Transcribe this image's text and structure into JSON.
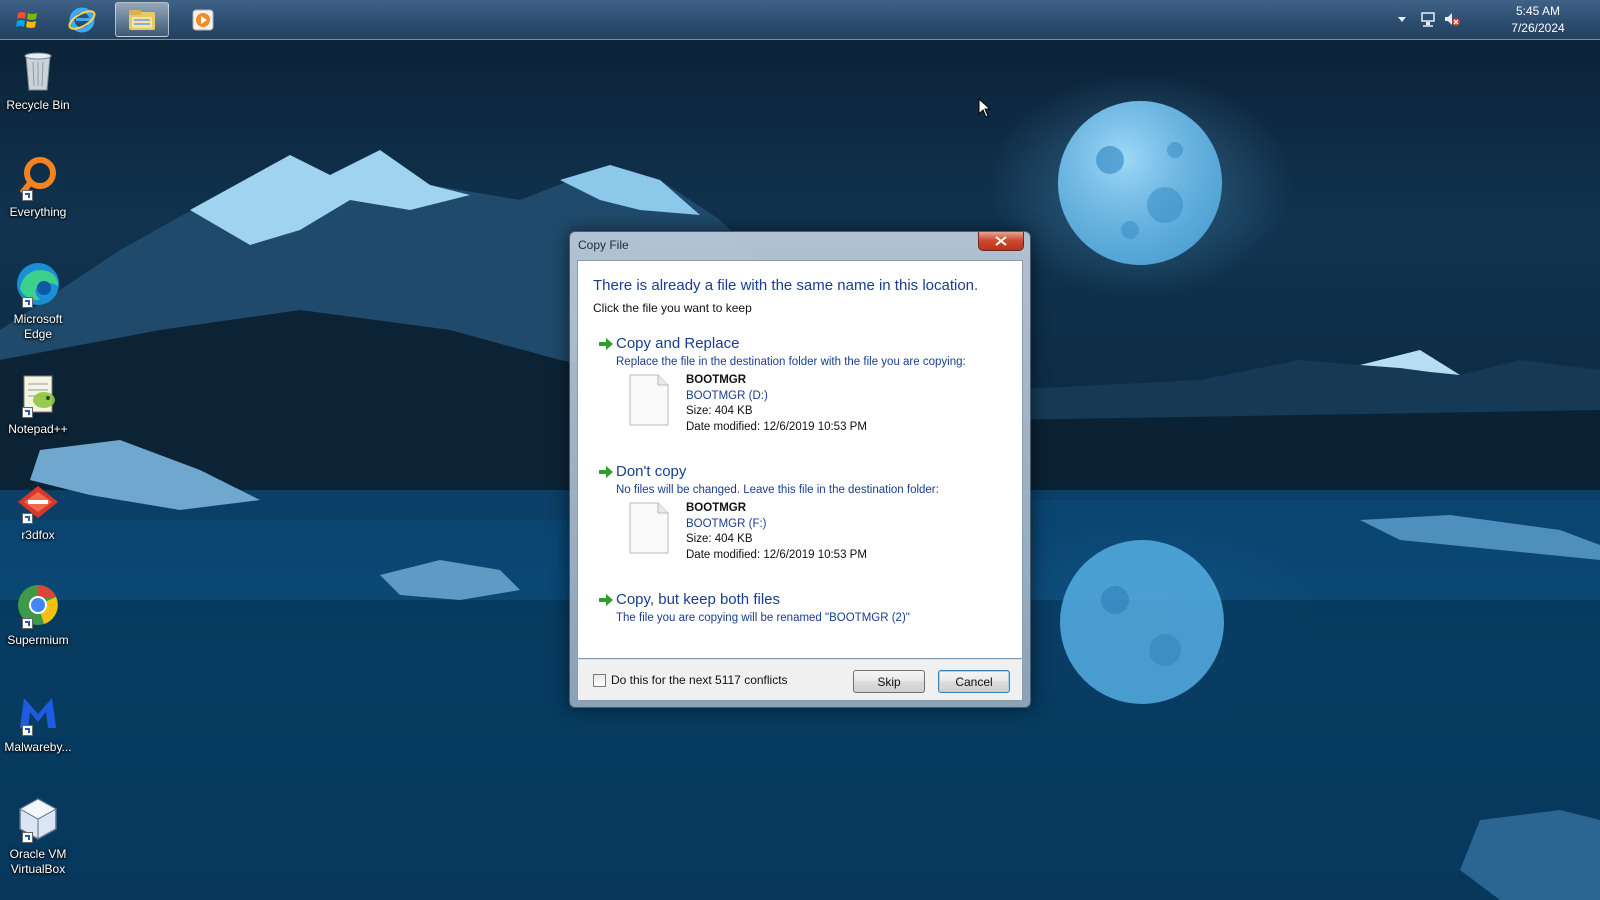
{
  "taskbar": {
    "start_icon": "windows-start-orb",
    "pinned": [
      {
        "name": "internet-explorer-icon"
      },
      {
        "name": "file-explorer-icon",
        "active": true
      },
      {
        "name": "media-player-icon"
      }
    ],
    "tray": {
      "icons": [
        "show-hidden-icons-chevron",
        "network-icon",
        "volume-muted-icon"
      ],
      "time": "5:45 AM",
      "date": "7/26/2024"
    }
  },
  "desktop": {
    "icons": [
      {
        "label": "Recycle Bin",
        "icon": "recycle-bin-icon"
      },
      {
        "label": "Everything",
        "icon": "everything-search-icon"
      },
      {
        "label": "Microsoft Edge",
        "icon": "edge-icon"
      },
      {
        "label": "Notepad++",
        "icon": "notepadpp-icon"
      },
      {
        "label": "r3dfox",
        "icon": "r3dfox-icon"
      },
      {
        "label": "Supermium",
        "icon": "supermium-icon"
      },
      {
        "label": "Malwareby...",
        "icon": "malwarebytes-icon"
      },
      {
        "label": "Oracle VM VirtualBox",
        "icon": "virtualbox-icon"
      }
    ]
  },
  "dialog": {
    "title": "Copy File",
    "instruction": "There is already a file with the same name in this location.",
    "sub_instruction": "Click the file you want to keep",
    "options": [
      {
        "title": "Copy and Replace",
        "description": "Replace the file in the destination folder with the file you are copying:",
        "file": {
          "name": "BOOTMGR",
          "location": "BOOTMGR (D:)",
          "size": "Size: 404 KB",
          "modified": "Date modified: 12/6/2019 10:53 PM"
        }
      },
      {
        "title": "Don't copy",
        "description": "No files will be changed. Leave this file in the destination folder:",
        "file": {
          "name": "BOOTMGR",
          "location": "BOOTMGR (F:)",
          "size": "Size: 404 KB",
          "modified": "Date modified: 12/6/2019 10:53 PM"
        }
      },
      {
        "title": "Copy, but keep both files",
        "description": "The file you are copying will be renamed \"BOOTMGR (2)\""
      }
    ],
    "checkbox_label": "Do this for the next 5117 conflicts",
    "checkbox_checked": false,
    "skip_label": "Skip",
    "cancel_label": "Cancel"
  },
  "colors": {
    "instruction_blue": "#1a3d8f",
    "option_arrow_green": "#2f9e2f"
  }
}
